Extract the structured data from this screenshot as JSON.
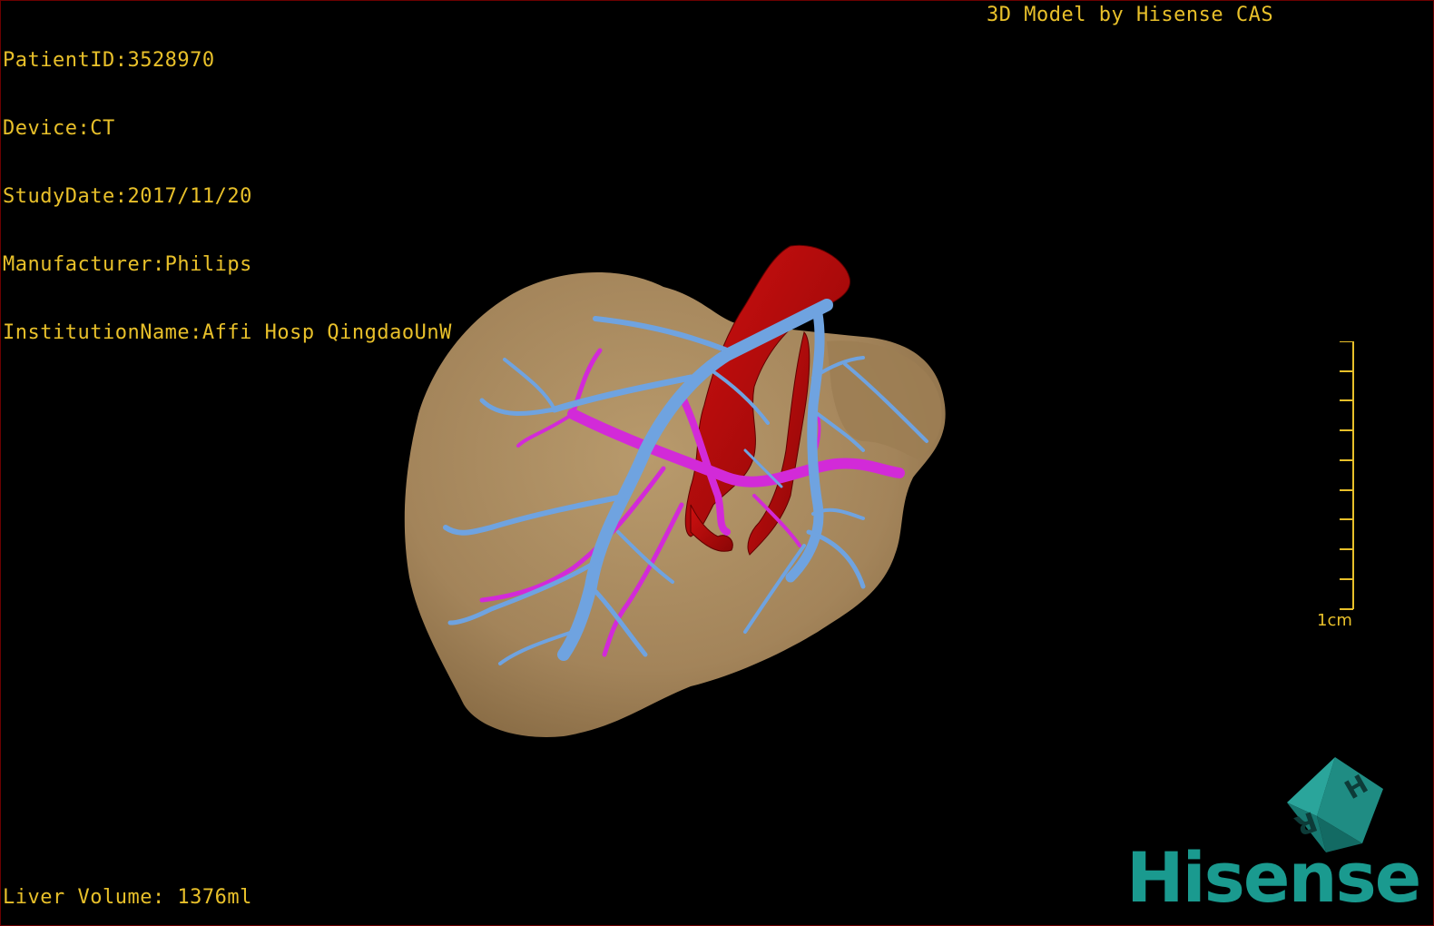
{
  "header": {
    "patient_id": "PatientID:3528970",
    "device": "Device:CT",
    "study_date": "StudyDate:2017/11/20",
    "manufacturer": "Manufacturer:Philips",
    "institution": "InstitutionName:Affi Hosp QingdaoUnW",
    "model_credit": "3D Model by Hisense CAS"
  },
  "footer": {
    "liver_volume": "Liver Volume: 1376ml"
  },
  "scale": {
    "label": "1cm"
  },
  "orientation_cube": {
    "top_face_label": "H",
    "side_face_label": "R"
  },
  "brand": {
    "name": "Hisense",
    "color": "#1a9a8f"
  },
  "colors": {
    "overlay_text": "#e8c02a",
    "liver": "#a8895f",
    "hepatic_vein": "#6fa3e0",
    "portal_vein": "#d22ad8",
    "artery_ivc": "#b00a0a",
    "background": "#000000"
  }
}
